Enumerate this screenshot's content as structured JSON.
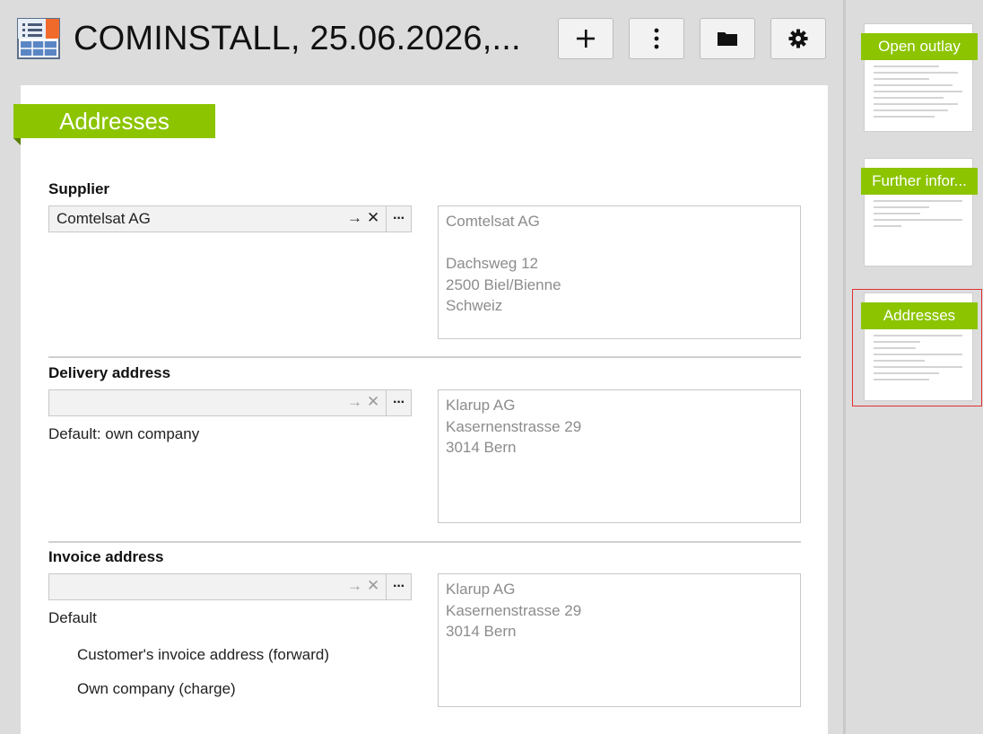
{
  "header": {
    "title": "COMINSTALL, 25.06.2026,...",
    "buttons": [
      {
        "name": "add",
        "icon": "plus-icon"
      },
      {
        "name": "more",
        "icon": "vertical-ellipsis-icon"
      },
      {
        "name": "folder",
        "icon": "folder-icon"
      },
      {
        "name": "settings",
        "icon": "gear-icon"
      }
    ]
  },
  "section": {
    "title": "Addresses"
  },
  "supplier": {
    "label": "Supplier",
    "value": "Comtelsat AG",
    "address_lines": [
      "Comtelsat AG",
      "",
      "Dachsweg 12",
      "2500 Biel/Bienne",
      "Schweiz"
    ]
  },
  "delivery": {
    "label": "Delivery address",
    "value": "",
    "note": "Default: own company",
    "address_lines": [
      "Klarup AG",
      "Kasernenstrasse 29",
      "3014 Bern"
    ]
  },
  "invoice": {
    "label": "Invoice address",
    "value": "",
    "note": "Default",
    "option_1": "Customer's invoice address (forward)",
    "option_2": "Own company (charge)",
    "address_lines": [
      "Klarup AG",
      "Kasernenstrasse 29",
      "3014 Bern"
    ]
  },
  "glyphs": {
    "goto": "→",
    "clear": "✕",
    "more": "···"
  },
  "thumbnails": [
    {
      "title": "Open outlay",
      "active": false
    },
    {
      "title": "Further infor...",
      "active": false
    },
    {
      "title": "Addresses",
      "active": true
    }
  ],
  "colors": {
    "accent": "#8cc400",
    "accent_dark": "#5b7f00",
    "selected_outline": "#e03131"
  }
}
